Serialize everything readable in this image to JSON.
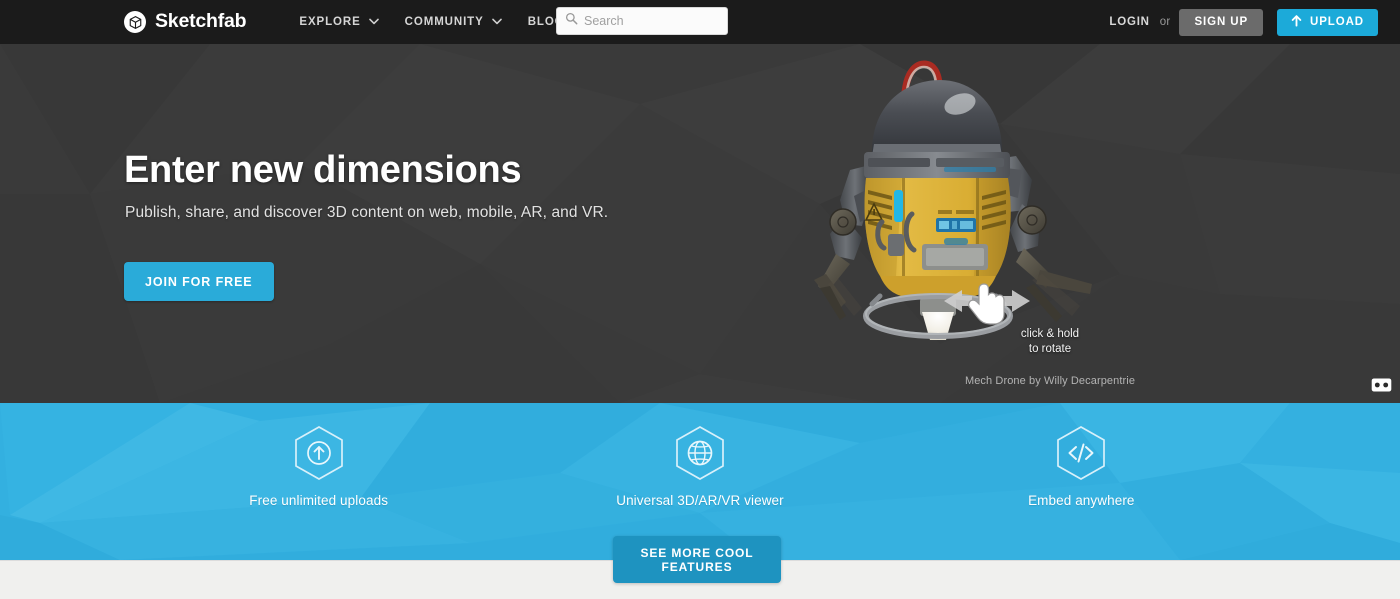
{
  "brand": {
    "name": "Sketchfab",
    "logo_icon": "sketchfab-cube-logo-icon"
  },
  "nav": {
    "items": [
      {
        "label": "EXPLORE",
        "caret_icon": "chevron-down-icon"
      },
      {
        "label": "COMMUNITY",
        "caret_icon": "chevron-down-icon"
      },
      {
        "label": "BLOG",
        "caret_icon": "chevron-down-icon"
      }
    ]
  },
  "search": {
    "placeholder": "Search",
    "value": "",
    "icon": "search-icon"
  },
  "account": {
    "login_label": "LOGIN",
    "or_label": "or",
    "signup_label": "SIGN UP",
    "upload_label": "UPLOAD",
    "upload_icon": "upload-arrow-icon"
  },
  "hero": {
    "title": "Enter new dimensions",
    "subtitle": "Publish, share, and discover 3D content on web, mobile, AR, and VR.",
    "cta_label": "JOIN FOR FREE",
    "background_color": "#3a3a3a"
  },
  "viewer": {
    "model_name": "Mech Drone",
    "credit": "Mech Drone by Willy Decarpentrie",
    "rotate_hint_line1": "click & hold",
    "rotate_hint_line2": "to rotate",
    "hand_icon": "hand-pointer-icon",
    "vr_icon": "vr-goggles-icon"
  },
  "features": {
    "background_color": "#33b0e0",
    "items": [
      {
        "label": "Free unlimited uploads",
        "icon": "hexagon-upload-icon"
      },
      {
        "label": "Universal 3D/AR/VR viewer",
        "icon": "hexagon-globe-icon"
      },
      {
        "label": "Embed anywhere",
        "icon": "hexagon-code-icon"
      }
    ],
    "more_label": "SEE MORE COOL FEATURES"
  },
  "colors": {
    "accent_blue": "#1caad9",
    "button_blue": "#2aabd9",
    "dark_nav": "#1b1b1b",
    "footer_gray": "#f0f0ee"
  }
}
